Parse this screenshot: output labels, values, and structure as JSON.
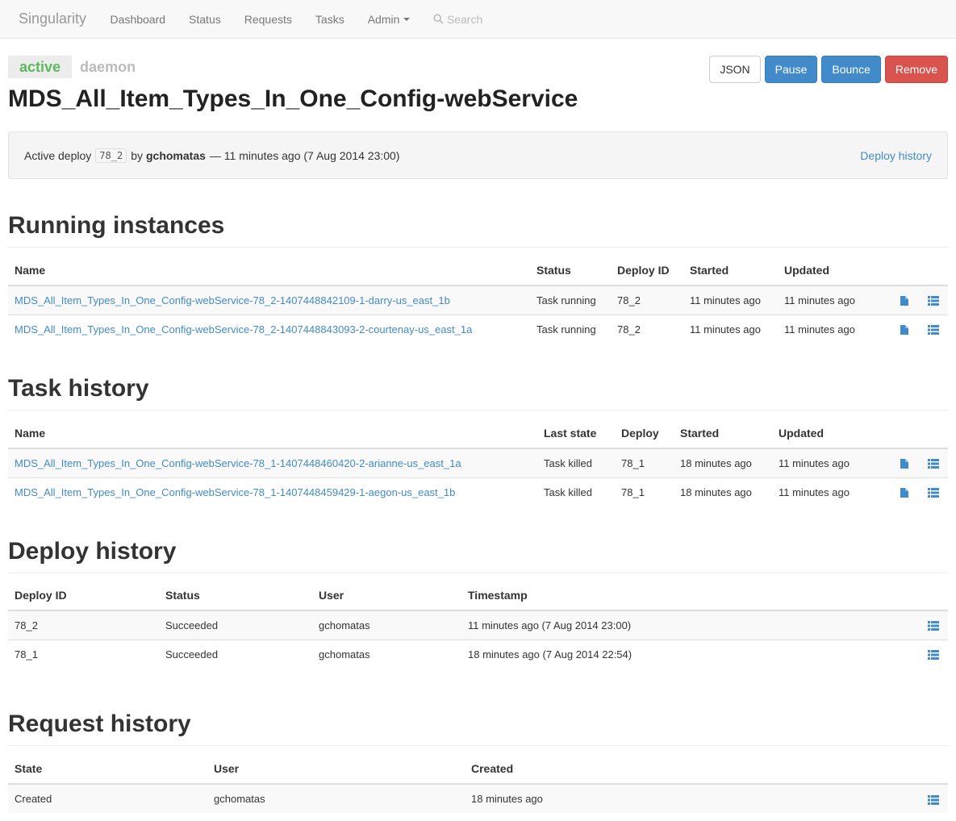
{
  "nav": {
    "brand": "Singularity",
    "items": [
      "Dashboard",
      "Status",
      "Requests",
      "Tasks",
      "Admin"
    ],
    "search_label": "Search"
  },
  "header": {
    "state_label": "active",
    "type_label": "daemon",
    "title": "MDS_All_Item_Types_In_One_Config-webService",
    "buttons": {
      "json": "JSON",
      "pause": "Pause",
      "bounce": "Bounce",
      "remove": "Remove"
    }
  },
  "active_deploy": {
    "prefix": "Active deploy",
    "deploy_id": "78_2",
    "by": "by",
    "user": "gchomatas",
    "when": "— 11 minutes ago (7 Aug 2014 23:00)",
    "link": "Deploy history"
  },
  "running": {
    "title": "Running instances",
    "headers": [
      "Name",
      "Status",
      "Deploy ID",
      "Started",
      "Updated"
    ],
    "rows": [
      {
        "name": "MDS_All_Item_Types_In_One_Config-webService-78_2-1407448842109-1-darry-us_east_1b",
        "status": "Task running",
        "deploy": "78_2",
        "started": "11 minutes ago",
        "updated": "11 minutes ago"
      },
      {
        "name": "MDS_All_Item_Types_In_One_Config-webService-78_2-1407448843093-2-courtenay-us_east_1a",
        "status": "Task running",
        "deploy": "78_2",
        "started": "11 minutes ago",
        "updated": "11 minutes ago"
      }
    ]
  },
  "tasks": {
    "title": "Task history",
    "headers": [
      "Name",
      "Last state",
      "Deploy",
      "Started",
      "Updated"
    ],
    "rows": [
      {
        "name": "MDS_All_Item_Types_In_One_Config-webService-78_1-1407448460420-2-arianne-us_east_1a",
        "state": "Task killed",
        "deploy": "78_1",
        "started": "18 minutes ago",
        "updated": "11 minutes ago"
      },
      {
        "name": "MDS_All_Item_Types_In_One_Config-webService-78_1-1407448459429-1-aegon-us_east_1b",
        "state": "Task killed",
        "deploy": "78_1",
        "started": "18 minutes ago",
        "updated": "11 minutes ago"
      }
    ]
  },
  "deploys": {
    "title": "Deploy history",
    "headers": [
      "Deploy ID",
      "Status",
      "User",
      "Timestamp"
    ],
    "rows": [
      {
        "id": "78_2",
        "status": "Succeeded",
        "user": "gchomatas",
        "timestamp": "11 minutes ago (7 Aug 2014 23:00)"
      },
      {
        "id": "78_1",
        "status": "Succeeded",
        "user": "gchomatas",
        "timestamp": "18 minutes ago (7 Aug 2014 22:54)"
      }
    ]
  },
  "requests": {
    "title": "Request history",
    "headers": [
      "State",
      "User",
      "Created"
    ],
    "rows": [
      {
        "state": "Created",
        "user": "gchomatas",
        "created": "18 minutes ago"
      }
    ]
  },
  "icons": {
    "file": "file-icon",
    "list": "list-icon",
    "search": "search-icon",
    "caret": "caret-down-icon"
  },
  "colors": {
    "link": "#428bca",
    "active": "#5cb85c",
    "primary": "#428bca",
    "danger": "#d9534f"
  }
}
